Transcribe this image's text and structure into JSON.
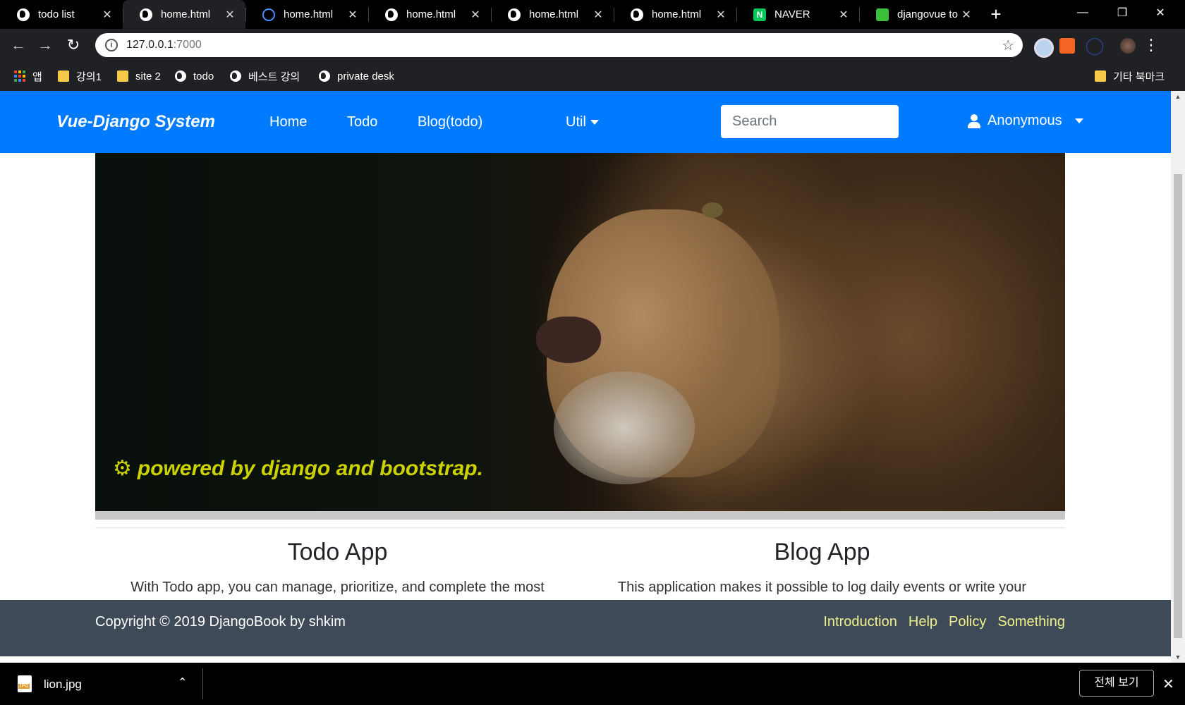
{
  "browser": {
    "tabs": [
      {
        "title": "todo list",
        "favicon": "globe-icon"
      },
      {
        "title": "home.html",
        "favicon": "globe-icon",
        "active": true
      },
      {
        "title": "home.html",
        "favicon": "loading-ring-icon"
      },
      {
        "title": "home.html",
        "favicon": "globe-icon"
      },
      {
        "title": "home.html",
        "favicon": "globe-icon"
      },
      {
        "title": "home.html",
        "favicon": "globe-icon"
      },
      {
        "title": "NAVER",
        "favicon": "naver-icon",
        "favicon_letter": "N"
      },
      {
        "title": "djangovue to",
        "favicon": "djangovue-icon"
      }
    ],
    "new_tab_symbol": "+",
    "url_host": "127.0.0.1",
    "url_port": ":7000",
    "bookmarks": [
      {
        "label": "앱",
        "icon": "apps-icon"
      },
      {
        "label": "강의1",
        "icon": "folder-icon"
      },
      {
        "label": "site 2",
        "icon": "folder-icon"
      },
      {
        "label": "todo",
        "icon": "globe-icon"
      },
      {
        "label": "베스트 강의",
        "icon": "globe-icon"
      },
      {
        "label": "private desk",
        "icon": "globe-icon"
      },
      {
        "label": "기타 북마크",
        "icon": "folder-icon"
      }
    ]
  },
  "navbar": {
    "brand": "Vue-Django System",
    "links": [
      "Home",
      "Todo",
      "Blog(todo)"
    ],
    "util": "Util",
    "search_placeholder": "Search",
    "user": "Anonymous",
    "color": "#007bff"
  },
  "hero": {
    "caption": "powered by django and bootstrap.",
    "caption_color": "#ccd200"
  },
  "cards": [
    {
      "title": "Todo App",
      "text": "With Todo app, you can manage, prioritize, and complete the most"
    },
    {
      "title": "Blog App",
      "text": "This application makes it possible to log daily events or write your own"
    }
  ],
  "footer": {
    "copyright": "Copyright © 2019 DjangoBook by shkim",
    "links": [
      "Introduction",
      "Help",
      "Policy",
      "Something"
    ],
    "bg": "#3f4a58"
  },
  "downloads": {
    "file_name": "lion.jpg",
    "show_all": "전체 보기"
  }
}
